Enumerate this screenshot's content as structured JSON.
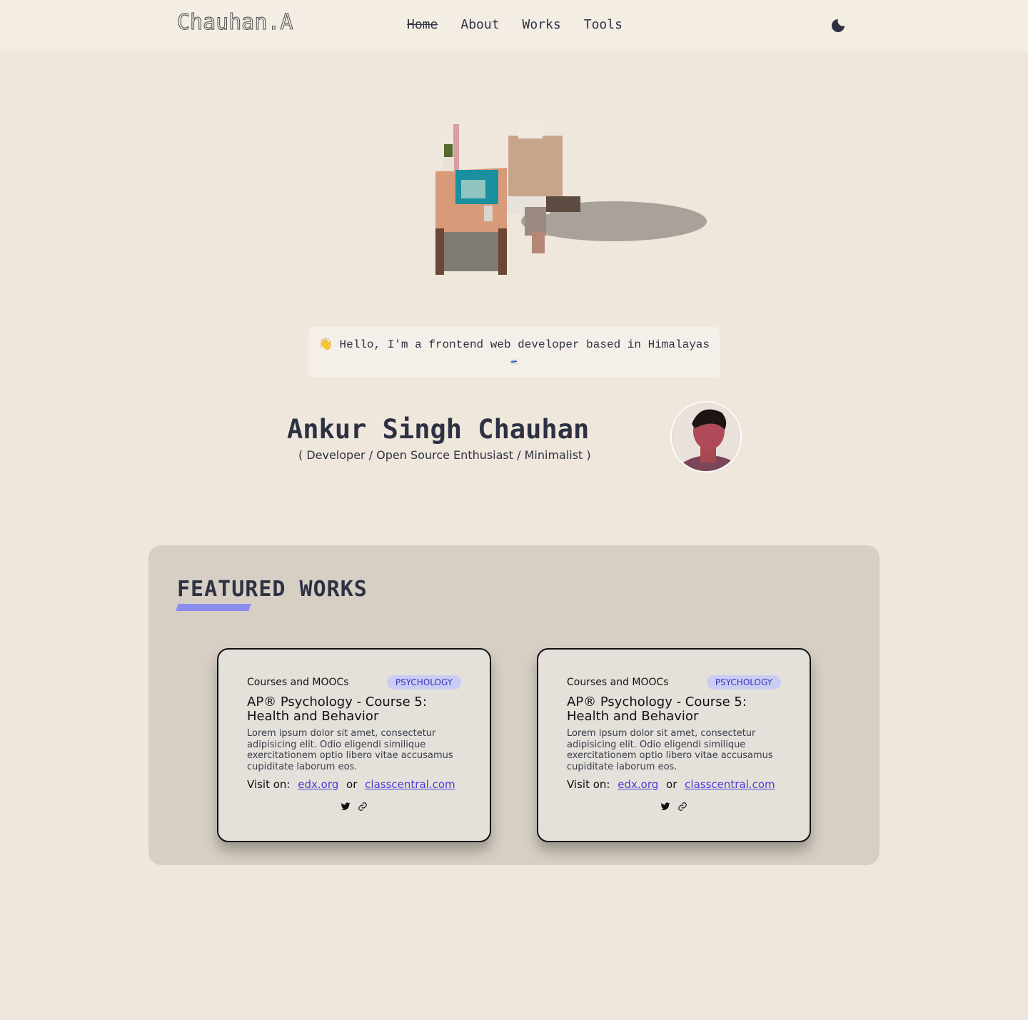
{
  "header": {
    "logo": "Chauhan.A",
    "nav": [
      {
        "label": "Home",
        "active": true
      },
      {
        "label": "About",
        "active": false
      },
      {
        "label": "Works",
        "active": false
      },
      {
        "label": "Tools",
        "active": false
      }
    ],
    "theme_toggle_icon": "moon-icon"
  },
  "hero": {
    "greeting_line1": "👋 Hello, I'm a frontend web developer based in Himalayas",
    "greeting_line2": "🗻",
    "name": "Ankur Singh Chauhan",
    "tagline": "( Developer / Open Source Enthusiast / Minimalist )"
  },
  "featured": {
    "title": "FEATURED WORKS",
    "accent_color": "#8a8cf0",
    "cards": [
      {
        "category": "Courses and MOOCs",
        "tag": "PSYCHOLOGY",
        "title": "AP® Psychology - Course 5: Health and Behavior",
        "description": "Lorem ipsum dolor sit amet, consectetur adipisicing elit. Odio eligendi similique exercitationem optio libero vitae accusamus cupiditate laborum eos.",
        "visit_label": "Visit on:",
        "link1": "edx.org",
        "or": "or",
        "link2": "classcentral.com",
        "icons": [
          "twitter-icon",
          "link-icon"
        ]
      },
      {
        "category": "Courses and MOOCs",
        "tag": "PSYCHOLOGY",
        "title": "AP® Psychology - Course 5: Health and Behavior",
        "description": "Lorem ipsum dolor sit amet, consectetur adipisicing elit. Odio eligendi similique exercitationem optio libero vitae accusamus cupiditate laborum eos.",
        "visit_label": "Visit on:",
        "link1": "edx.org",
        "or": "or",
        "link2": "classcentral.com",
        "icons": [
          "twitter-icon",
          "link-icon"
        ]
      }
    ]
  }
}
